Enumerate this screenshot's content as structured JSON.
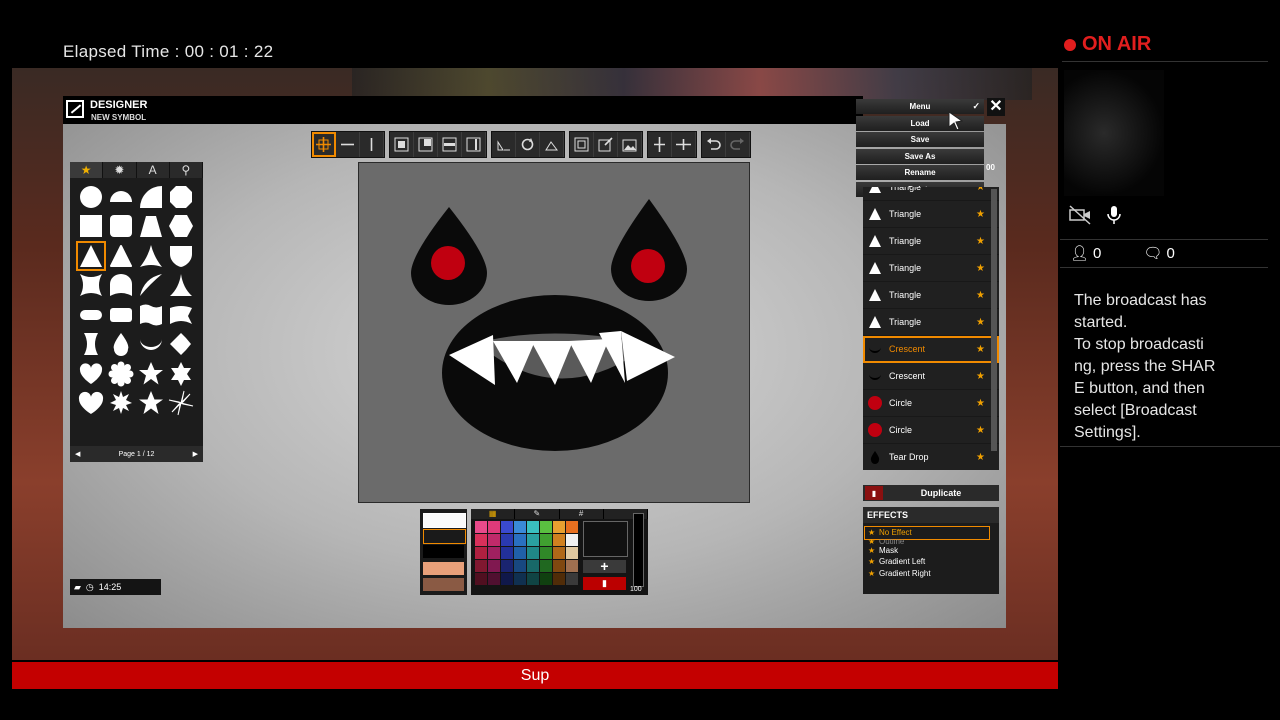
{
  "stream": {
    "elapsed_label": "Elapsed Time :",
    "elapsed_value": "00 : 01 : 22",
    "on_air": "ON AIR",
    "viewers": "0",
    "comments": "0",
    "notice_lines": [
      "The broadcast has",
      "started.",
      "To stop broadcasti",
      "ng, press the SHAR",
      "E button, and then",
      "select [Broadcast",
      "Settings]."
    ],
    "message_bar": "Sup"
  },
  "designer": {
    "title": "DESIGNER",
    "subtitle": "NEW SYMBOL",
    "close_icon": "close-icon",
    "shape_tabs": [
      "★",
      "✹",
      "A",
      "⚲"
    ],
    "page_label": "Page 1 / 12",
    "clock": "14:25",
    "menu": {
      "header": "Menu",
      "items": [
        "Load",
        "Save",
        "Save As",
        "Rename",
        "Delete"
      ],
      "counter": "00"
    },
    "layers": [
      {
        "name": "Triangle",
        "icon": "triangle"
      },
      {
        "name": "Triangle",
        "icon": "triangle"
      },
      {
        "name": "Triangle",
        "icon": "triangle"
      },
      {
        "name": "Triangle",
        "icon": "triangle"
      },
      {
        "name": "Triangle",
        "icon": "triangle"
      },
      {
        "name": "Triangle",
        "icon": "triangle"
      },
      {
        "name": "Crescent",
        "icon": "crescent"
      },
      {
        "name": "Crescent",
        "icon": "crescent"
      },
      {
        "name": "Circle",
        "icon": "circle-red"
      },
      {
        "name": "Circle",
        "icon": "circle-red"
      },
      {
        "name": "Tear Drop",
        "icon": "teardrop"
      }
    ],
    "duplicate_label": "Duplicate",
    "effects_title": "EFFECTS",
    "effects": [
      "No Effect",
      "Outline",
      "Mask",
      "Gradient Left",
      "Gradient Right"
    ],
    "opacity_value": "100",
    "colors": {
      "accent": "#f08a00",
      "canvas_bg": "#6b6b6b",
      "eye_red": "#c00010",
      "on_air_red": "#e21e1e",
      "bar_red": "#c40000"
    }
  }
}
